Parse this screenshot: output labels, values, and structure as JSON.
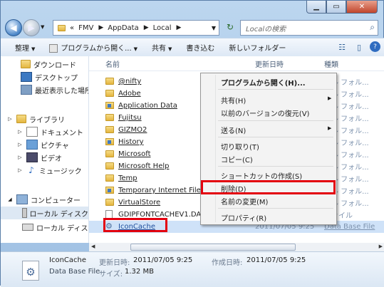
{
  "titlebar": {
    "minimize_icon": "minimize-icon",
    "maximize_icon": "maximize-icon",
    "close_icon": "close-icon"
  },
  "address": {
    "path": [
      "FMV",
      "AppData",
      "Local"
    ],
    "prefix": "«"
  },
  "search": {
    "placeholder": "Localの検索"
  },
  "toolbar": {
    "organize": "整理",
    "open_with": "プログラムから開く...",
    "share": "共有",
    "burn": "書き込む",
    "new_folder": "新しいフォルダー"
  },
  "sidebar": {
    "items": [
      {
        "label": "ダウンロード",
        "icon": "download-folder-icon"
      },
      {
        "label": "デスクトップ",
        "icon": "desktop-icon"
      },
      {
        "label": "最近表示した場所",
        "icon": "recent-places-icon"
      },
      {
        "label": "ライブラリ",
        "icon": "library-icon"
      },
      {
        "label": "ドキュメント",
        "icon": "documents-icon"
      },
      {
        "label": "ピクチャ",
        "icon": "pictures-icon"
      },
      {
        "label": "ビデオ",
        "icon": "videos-icon"
      },
      {
        "label": "ミュージック",
        "icon": "music-icon"
      },
      {
        "label": "コンピューター",
        "icon": "computer-icon"
      },
      {
        "label": "ローカル ディスク",
        "icon": "local-disk-icon"
      },
      {
        "label": "ローカル ディスク",
        "icon": "local-disk-icon"
      }
    ]
  },
  "columns": {
    "name": "名前",
    "date": "更新日時",
    "type": "種類"
  },
  "files": [
    {
      "name": "@nifty",
      "kind": "folder"
    },
    {
      "name": "Adobe",
      "kind": "folder"
    },
    {
      "name": "Application Data",
      "kind": "shortcut"
    },
    {
      "name": "Fujitsu",
      "kind": "folder"
    },
    {
      "name": "GIZMO2",
      "kind": "folder"
    },
    {
      "name": "History",
      "kind": "shortcut"
    },
    {
      "name": "Microsoft",
      "kind": "folder"
    },
    {
      "name": "Microsoft Help",
      "kind": "folder"
    },
    {
      "name": "Temp",
      "kind": "folder"
    },
    {
      "name": "Temporary Internet Files",
      "kind": "shortcut"
    },
    {
      "name": "VirtualStore",
      "kind": "folder"
    },
    {
      "name": "GDIPFONTCACHEV1.DAT",
      "kind": "file",
      "type": "ファイル"
    },
    {
      "name": "IconCache",
      "kind": "file",
      "date": "2011/07/05 9:25",
      "type": "Data Base File"
    }
  ],
  "type_partial": "イル フォル...",
  "context_menu": {
    "open_with": "プログラムから開く(H)...",
    "share": "共有(H)",
    "restore": "以前のバージョンの復元(V)",
    "send_to": "送る(N)",
    "cut": "切り取り(T)",
    "copy": "コピー(C)",
    "create_shortcut": "ショートカットの作成(S)",
    "delete": "削除(D)",
    "rename": "名前の変更(M)",
    "properties": "プロパティ(R)"
  },
  "details": {
    "name": "IconCache",
    "type": "Data Base File",
    "modified_label": "更新日時:",
    "modified": "2011/07/05 9:25",
    "created_label": "作成日時:",
    "created": "2011/07/05 9:25",
    "size_label": "サイズ:",
    "size": "1.32 MB"
  },
  "colors": {
    "highlight": "#e3000f",
    "selection": "#cfe2f8"
  }
}
